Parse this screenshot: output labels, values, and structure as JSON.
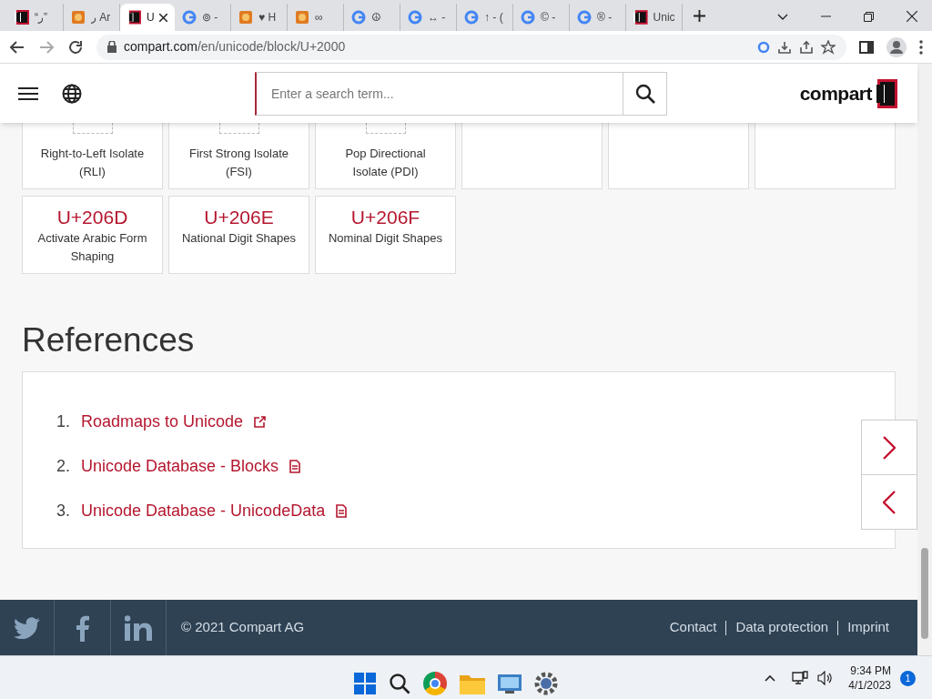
{
  "browser": {
    "tabs": [
      {
        "title": "“ر”",
        "kind": "compart",
        "selected": false
      },
      {
        "title": "ر Ar",
        "kind": "orange",
        "selected": false
      },
      {
        "title": "U",
        "kind": "compart",
        "selected": true
      },
      {
        "title": "⊚ -",
        "kind": "google",
        "selected": false
      },
      {
        "title": "♥ H",
        "kind": "orange",
        "selected": false
      },
      {
        "title": "∞",
        "kind": "orange",
        "selected": false
      },
      {
        "title": "☮",
        "kind": "google",
        "selected": false
      },
      {
        "title": "↔ -",
        "kind": "google",
        "selected": false
      },
      {
        "title": "↑ - (",
        "kind": "google",
        "selected": false
      },
      {
        "title": "© -",
        "kind": "google",
        "selected": false
      },
      {
        "title": "® -",
        "kind": "google",
        "selected": false
      },
      {
        "title": "Unic",
        "kind": "compart",
        "selected": false
      }
    ],
    "url_host": "compart.com",
    "url_path": "/en/unicode/block/U+2000"
  },
  "header": {
    "search_placeholder": "Enter a search term...",
    "logo": "compart"
  },
  "cards": [
    {
      "name": "Right-to-Left Isolate (RLI)",
      "kind": "partial"
    },
    {
      "name": "First Strong Isolate (FSI)",
      "kind": "partial"
    },
    {
      "name": "Pop Directional Isolate (PDI)",
      "kind": "partial"
    },
    {
      "kind": "empty"
    },
    {
      "kind": "empty"
    },
    {
      "kind": "empty"
    },
    {
      "code": "U+206D",
      "name": "Activate Arabic Form Shaping",
      "kind": "full"
    },
    {
      "code": "U+206E",
      "name": "National Digit Shapes",
      "kind": "full"
    },
    {
      "code": "U+206F",
      "name": "Nominal Digit Shapes",
      "kind": "full"
    }
  ],
  "references": {
    "heading": "References",
    "items": [
      {
        "number": "1.",
        "label": "Roadmaps to Unicode",
        "kind": "external"
      },
      {
        "number": "2.",
        "label": "Unicode Database - Blocks",
        "kind": "document"
      },
      {
        "number": "3.",
        "label": "Unicode Database - UnicodeData",
        "kind": "document"
      }
    ]
  },
  "footer": {
    "copyright": "© 2021 Compart AG",
    "links": [
      "Contact",
      "Data protection",
      "Imprint"
    ]
  },
  "taskbar": {
    "time": "9:34 PM",
    "date": "4/1/2023",
    "notifications": "1"
  }
}
